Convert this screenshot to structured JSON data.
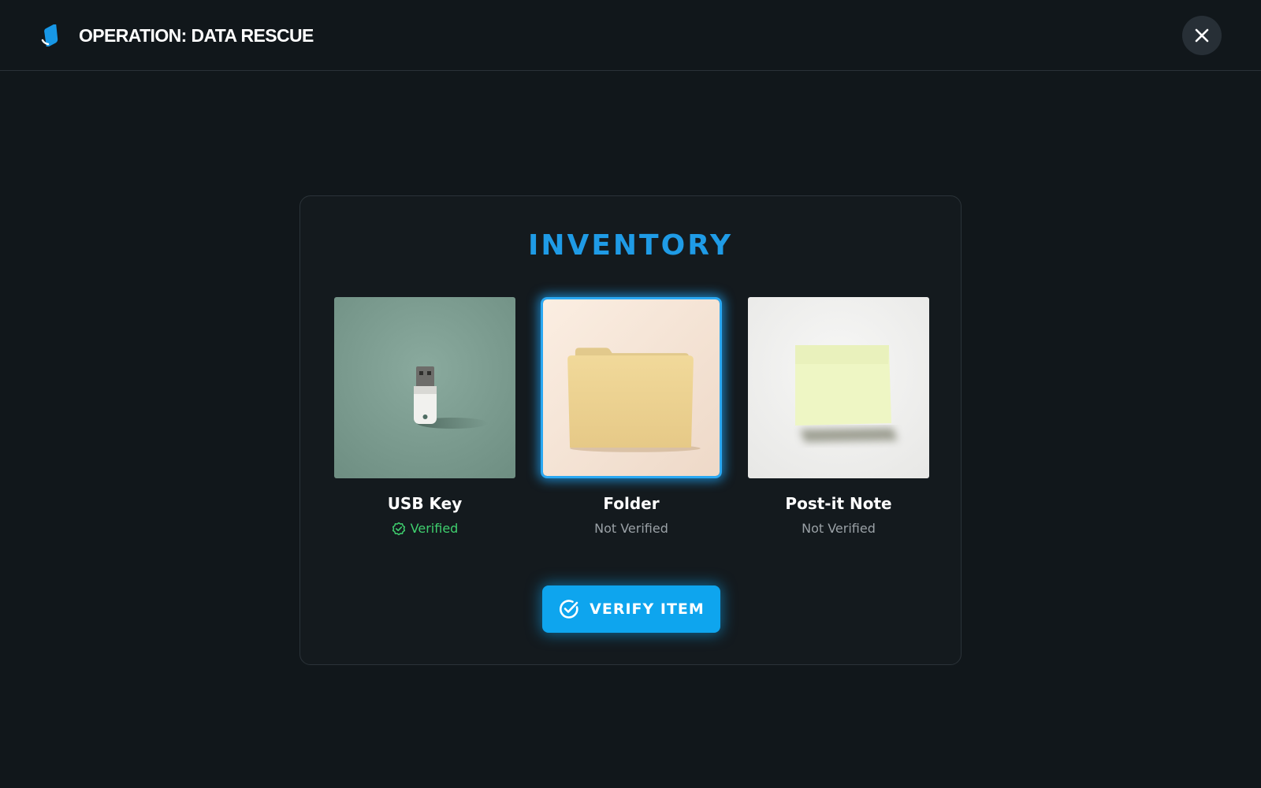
{
  "header": {
    "title": "OPERATION: DATA RESCUE",
    "logo_icon": "diamond-tag-icon",
    "close_icon": "close-icon"
  },
  "inventory": {
    "title": "INVENTORY",
    "items": [
      {
        "name": "USB Key",
        "status": "Verified",
        "verified": true,
        "selected": false,
        "image": "usb-key-photo"
      },
      {
        "name": "Folder",
        "status": "Not Verified",
        "verified": false,
        "selected": true,
        "image": "folder-photo"
      },
      {
        "name": "Post-it Note",
        "status": "Not Verified",
        "verified": false,
        "selected": false,
        "image": "post-it-note-photo"
      }
    ],
    "verify_button_label": "VERIFY ITEM"
  },
  "colors": {
    "background": "#11171b",
    "accent": "#0ea5ee",
    "verified": "#3fcf6e",
    "muted": "#9aa1a6"
  }
}
